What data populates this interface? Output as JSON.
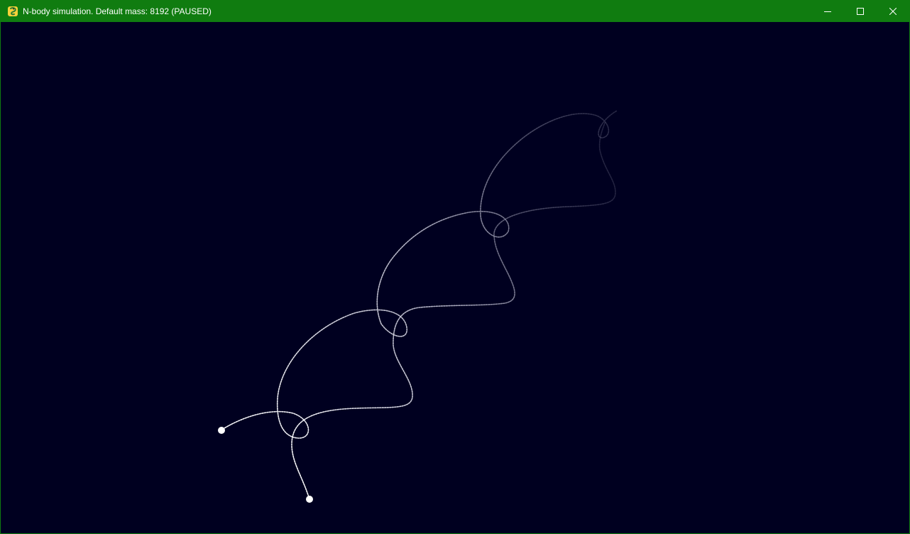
{
  "window": {
    "title": "N-body simulation. Default mass: 8192 (PAUSED)"
  },
  "title_controls": [
    "minimize",
    "maximize",
    "close"
  ],
  "simulation": {
    "bodies": 2,
    "trail_color": "#ffffff",
    "background_color": "#000020",
    "frame_color": "#107c10"
  }
}
